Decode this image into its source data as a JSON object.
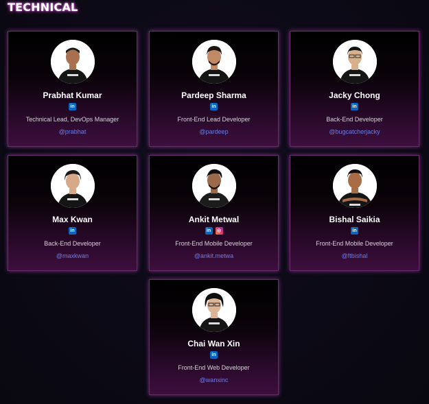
{
  "section": {
    "title": "TECHNICAL"
  },
  "members": [
    {
      "name": "Prabhat Kumar",
      "role": "Technical Lead, DevOps Manager",
      "handle": "@prabhat",
      "socials": [
        "linkedin"
      ]
    },
    {
      "name": "Pardeep Sharma",
      "role": "Front-End Lead Developer",
      "handle": "@pardeep",
      "socials": [
        "linkedin"
      ]
    },
    {
      "name": "Jacky Chong",
      "role": "Back-End Developer",
      "handle": "@bugcatcherjacky",
      "socials": [
        "linkedin"
      ]
    },
    {
      "name": "Max Kwan",
      "role": "Back-End Developer",
      "handle": "@maxkwan",
      "socials": [
        "linkedin"
      ]
    },
    {
      "name": "Ankit Metwal",
      "role": "Front-End Mobile Developer",
      "handle": "@ankit.metwa",
      "socials": [
        "linkedin",
        "instagram"
      ]
    },
    {
      "name": "Bishal Saikia",
      "role": "Front-End Mobile Developer",
      "handle": "@ftbishal",
      "socials": [
        "linkedin"
      ]
    },
    {
      "name": "Chai Wan Xin",
      "role": "Front-End Web Developer",
      "handle": "@wanxinc",
      "socials": [
        "linkedin"
      ]
    }
  ],
  "colors": {
    "title_glow": "#e85ce8",
    "card_border": "#6b2a6b",
    "handle": "#6f7fe8",
    "linkedin": "#0a66c2"
  },
  "icons": {
    "linkedin": "in",
    "instagram": "◎"
  }
}
